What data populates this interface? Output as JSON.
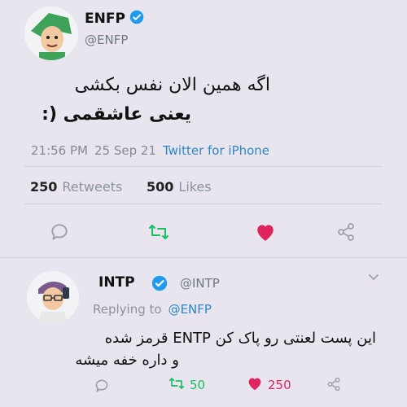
{
  "main_tweet": {
    "author_name": "ENFP",
    "author_handle": "@ENFP",
    "text_line1": "اگه همین الان نفس بکشی",
    "text_line2": "یعنی عاشقمی (:",
    "time": "21:56 PM",
    "date": "25 Sep 21",
    "source": "Twitter for iPhone",
    "retweets_count": "250",
    "retweets_label": "Retweets",
    "likes_count": "500",
    "likes_label": "Likes"
  },
  "reply_tweet": {
    "author_name": "INTP",
    "author_handle": "@INTP",
    "replying_to_label": "Replying to",
    "replying_to_handle": "@ENFP",
    "text_line1": "این پست لعنتی رو پاک کن ENTP قرمز شده",
    "text_line2": "و داره خفه میشه",
    "retweets_count": "50",
    "likes_count": "250"
  },
  "colors": {
    "background": "#e9e5ee",
    "verified": "#1d9bf0",
    "like_red": "#e0245e",
    "retweet_green": "#17bf63",
    "icon_gray": "#9aa3ad"
  },
  "icons": [
    "verified-badge-icon",
    "reply-icon",
    "retweet-icon",
    "heart-icon",
    "share-icon",
    "chevron-down-icon"
  ]
}
